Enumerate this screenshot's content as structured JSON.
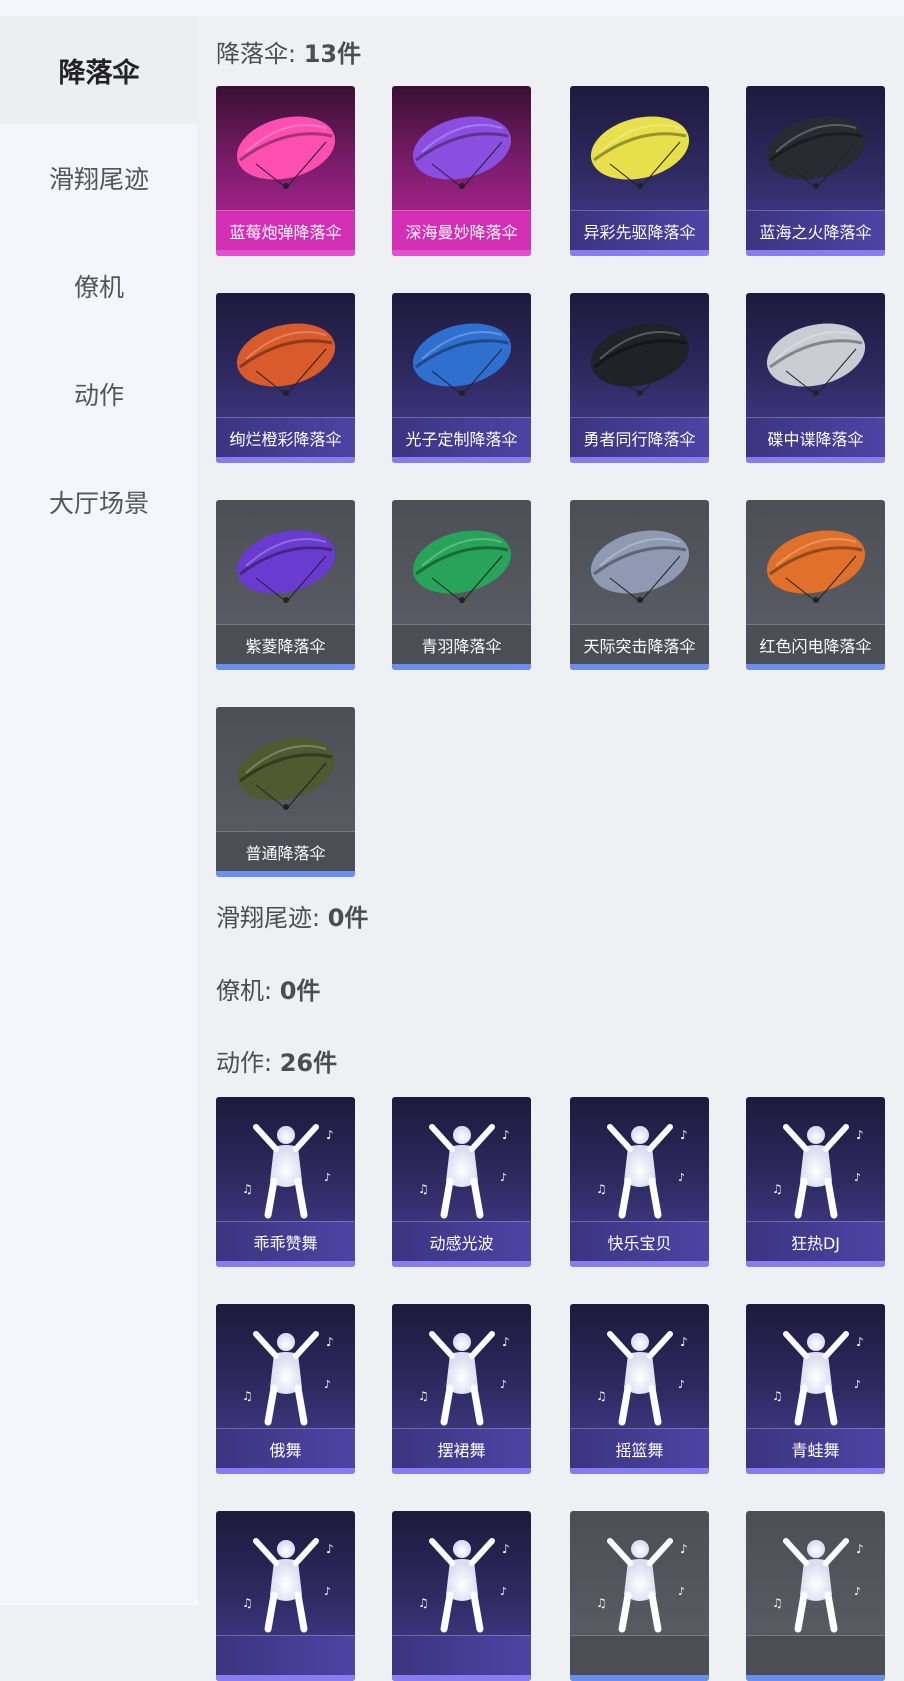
{
  "sidebar": {
    "items": [
      {
        "label": "降落伞",
        "active": true
      },
      {
        "label": "滑翔尾迹",
        "active": false
      },
      {
        "label": "僚机",
        "active": false
      },
      {
        "label": "动作",
        "active": false
      },
      {
        "label": "大厅场景",
        "active": false
      }
    ]
  },
  "sections": {
    "parachute": {
      "name": "降落伞: ",
      "count": "13件"
    },
    "trail": {
      "name": "滑翔尾迹: ",
      "count": "0件"
    },
    "wingman": {
      "name": "僚机: ",
      "count": "0件"
    },
    "emote": {
      "name": "动作: ",
      "count": "26件"
    }
  },
  "parachutes": [
    {
      "name": "蓝莓炮弹降落伞",
      "rarity": "pink",
      "color": "#ff4fb0"
    },
    {
      "name": "深海曼妙降落伞",
      "rarity": "pink",
      "color": "#8a4fe0"
    },
    {
      "name": "异彩先驱降落伞",
      "rarity": "purple",
      "color": "#e8e04a"
    },
    {
      "name": "蓝海之火降落伞",
      "rarity": "purple",
      "color": "#2a2a33"
    },
    {
      "name": "绚烂橙彩降落伞",
      "rarity": "purple",
      "color": "#d95a2a"
    },
    {
      "name": "光子定制降落伞",
      "rarity": "purple",
      "color": "#2f6fd0"
    },
    {
      "name": "勇者同行降落伞",
      "rarity": "purple",
      "color": "#1f2226"
    },
    {
      "name": "碟中谍降落伞",
      "rarity": "purple",
      "color": "#c9ccd2"
    },
    {
      "name": "紫菱降落伞",
      "rarity": "gray",
      "color": "#6a3bd0"
    },
    {
      "name": "青羽降落伞",
      "rarity": "gray",
      "color": "#27a35a"
    },
    {
      "name": "天际突击降落伞",
      "rarity": "gray",
      "color": "#8f9ab2"
    },
    {
      "name": "红色闪电降落伞",
      "rarity": "gray",
      "color": "#e0702a"
    },
    {
      "name": "普通降落伞",
      "rarity": "gray",
      "color": "#4f5a30"
    }
  ],
  "emotes": [
    {
      "name": "乖乖赞舞",
      "rarity": "purple"
    },
    {
      "name": "动感光波",
      "rarity": "purple"
    },
    {
      "name": "快乐宝贝",
      "rarity": "purple"
    },
    {
      "name": "狂热DJ",
      "rarity": "purple"
    },
    {
      "name": "俄舞",
      "rarity": "purple"
    },
    {
      "name": "摆裙舞",
      "rarity": "purple"
    },
    {
      "name": "摇篮舞",
      "rarity": "purple"
    },
    {
      "name": "青蛙舞",
      "rarity": "purple"
    },
    {
      "name": "",
      "rarity": "purple"
    },
    {
      "name": "",
      "rarity": "purple"
    },
    {
      "name": "",
      "rarity": "gray"
    },
    {
      "name": "",
      "rarity": "gray"
    }
  ]
}
